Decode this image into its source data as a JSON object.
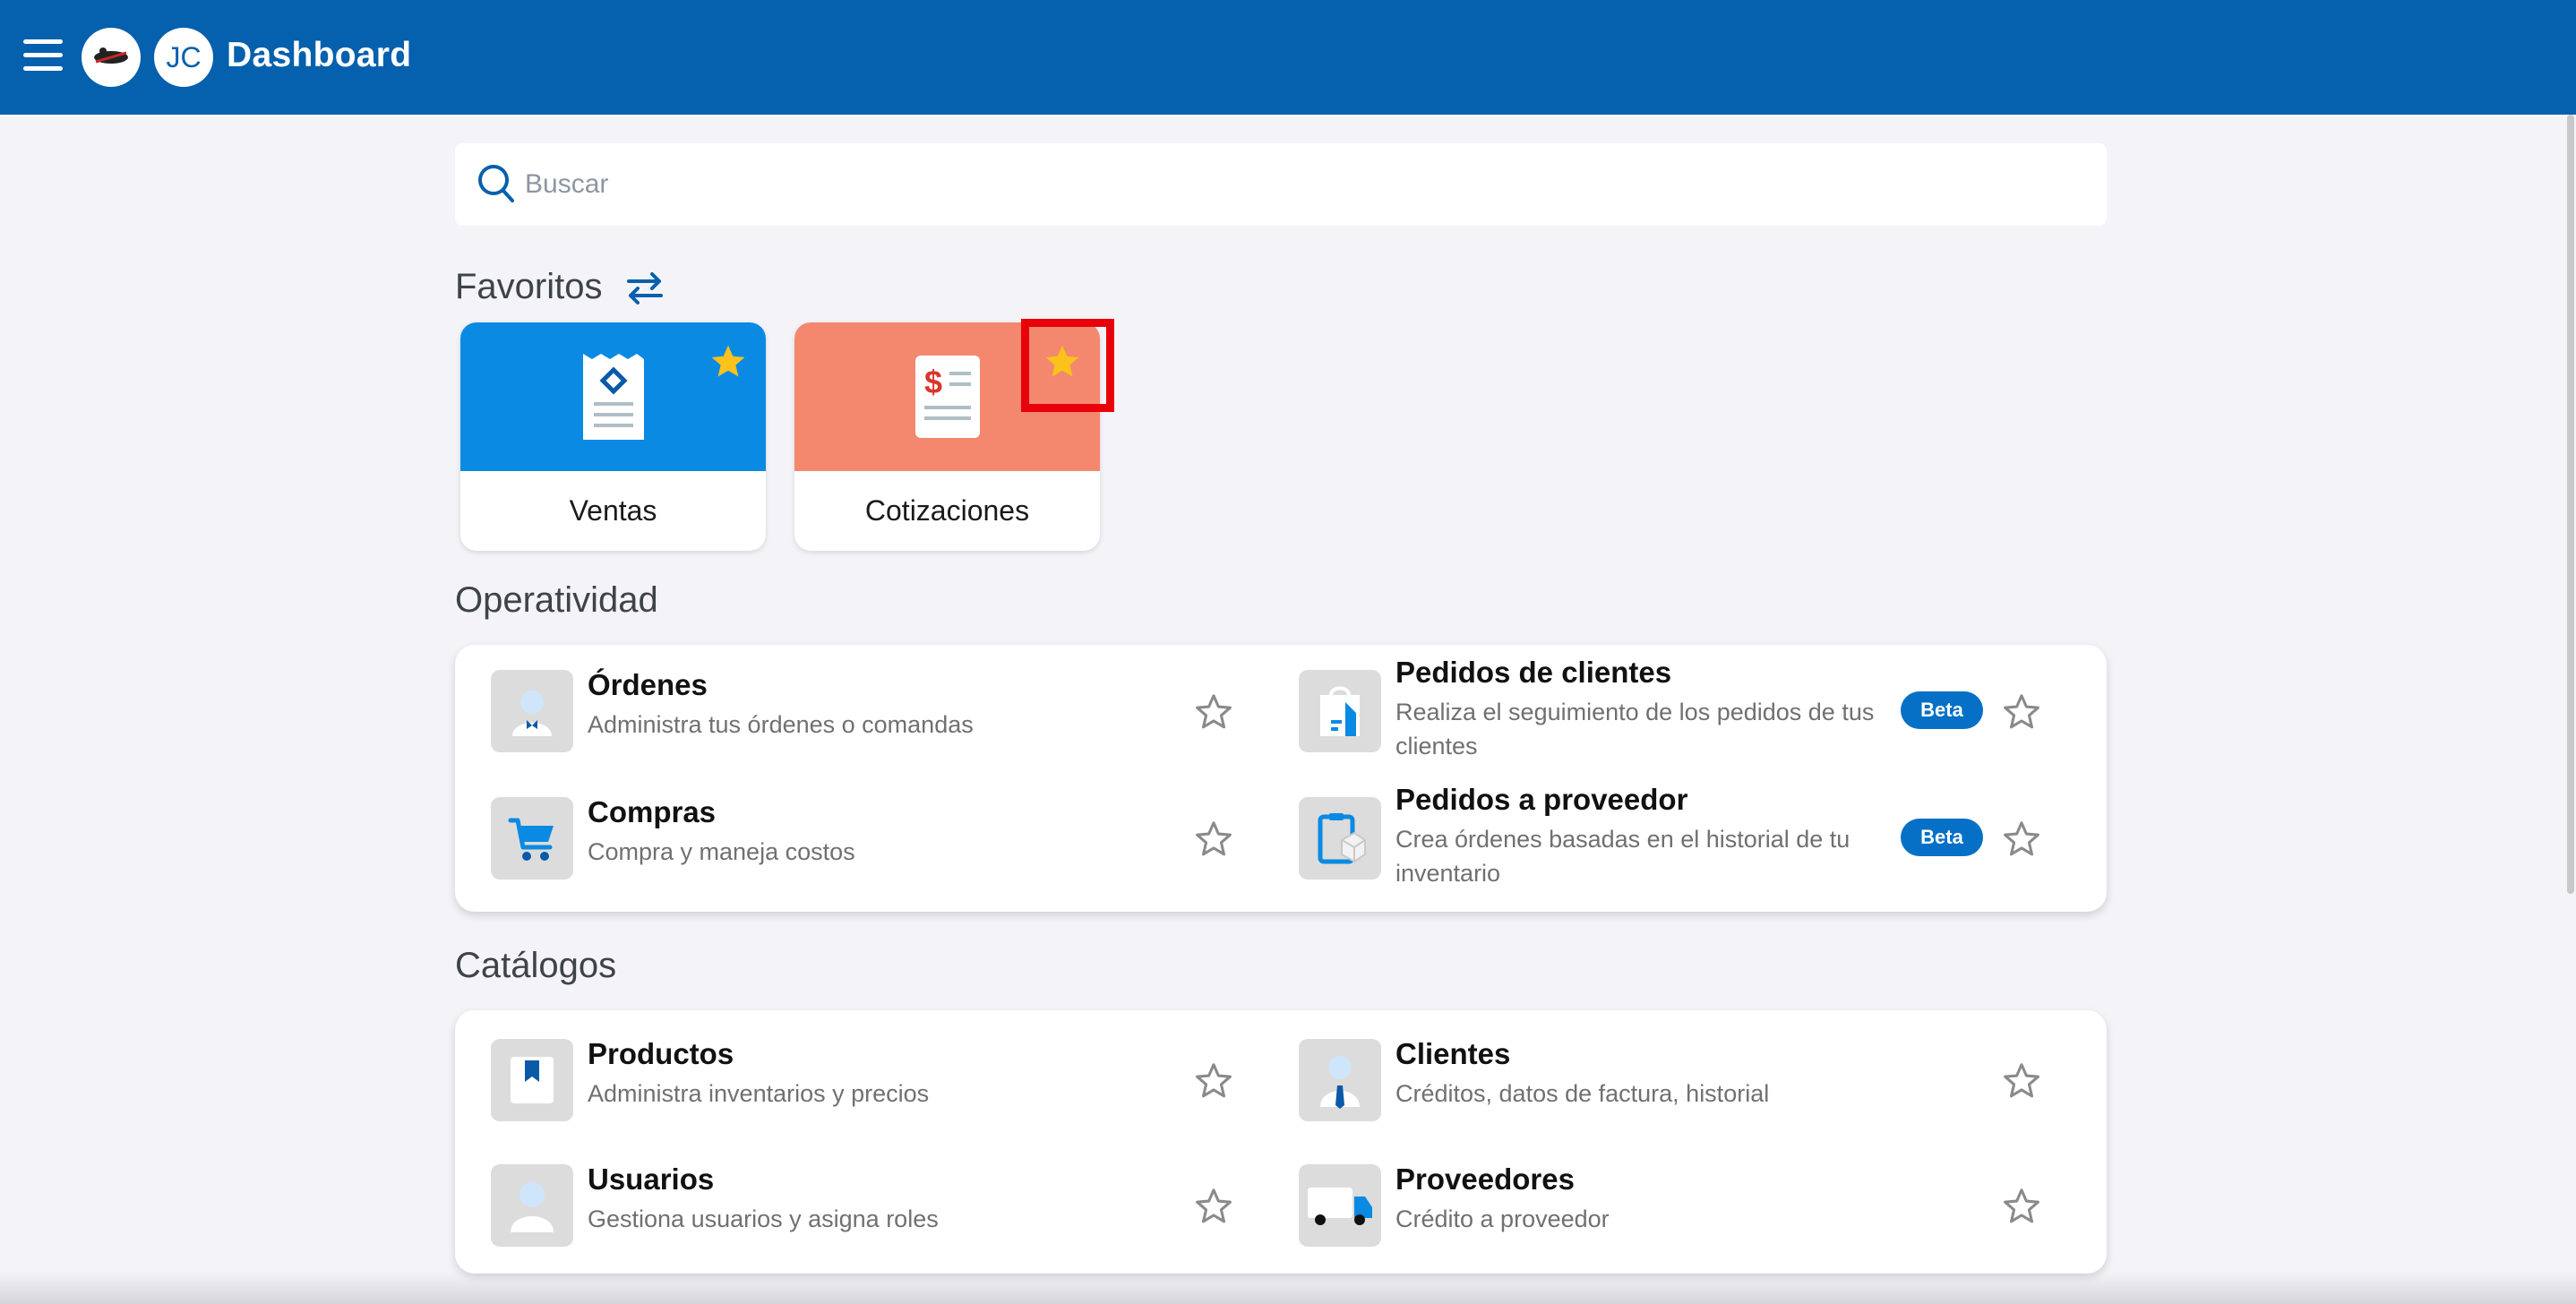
{
  "header": {
    "avatar_initials": "JC",
    "title": "Dashboard",
    "bar_color": "#0560ad"
  },
  "search": {
    "placeholder": "Buscar"
  },
  "favorites": {
    "title": "Favoritos",
    "cards": [
      {
        "label": "Ventas",
        "color": "#0a8ae3",
        "icon": "receipt-icon",
        "starred": true
      },
      {
        "label": "Cotizaciones",
        "color": "#f4886e",
        "icon": "quote-document-icon",
        "starred": true,
        "highlighted": true
      }
    ]
  },
  "operatividad": {
    "title": "Operatividad",
    "items": [
      {
        "name": "Órdenes",
        "desc": "Administra tus órdenes o comandas",
        "icon": "waiter-icon",
        "beta": false
      },
      {
        "name": "Pedidos de clientes",
        "desc": "Realiza el seguimiento de los pedidos de tus clientes",
        "icon": "shopping-bag-icon",
        "beta": true,
        "badge": "Beta"
      },
      {
        "name": "Compras",
        "desc": "Compra y maneja costos",
        "icon": "cart-icon",
        "beta": false
      },
      {
        "name": "Pedidos a proveedor",
        "desc": "Crea órdenes basadas en el historial de tu inventario",
        "icon": "clipboard-box-icon",
        "beta": true,
        "badge": "Beta"
      }
    ]
  },
  "catalogos": {
    "title": "Catálogos",
    "items": [
      {
        "name": "Productos",
        "desc": "Administra inventarios y precios",
        "icon": "product-tag-icon"
      },
      {
        "name": "Clientes",
        "desc": "Créditos, datos de factura, historial",
        "icon": "client-icon"
      },
      {
        "name": "Usuarios",
        "desc": "Gestiona usuarios y asigna roles",
        "icon": "user-icon"
      },
      {
        "name": "Proveedores",
        "desc": "Crédito a proveedor",
        "icon": "truck-icon"
      }
    ]
  }
}
